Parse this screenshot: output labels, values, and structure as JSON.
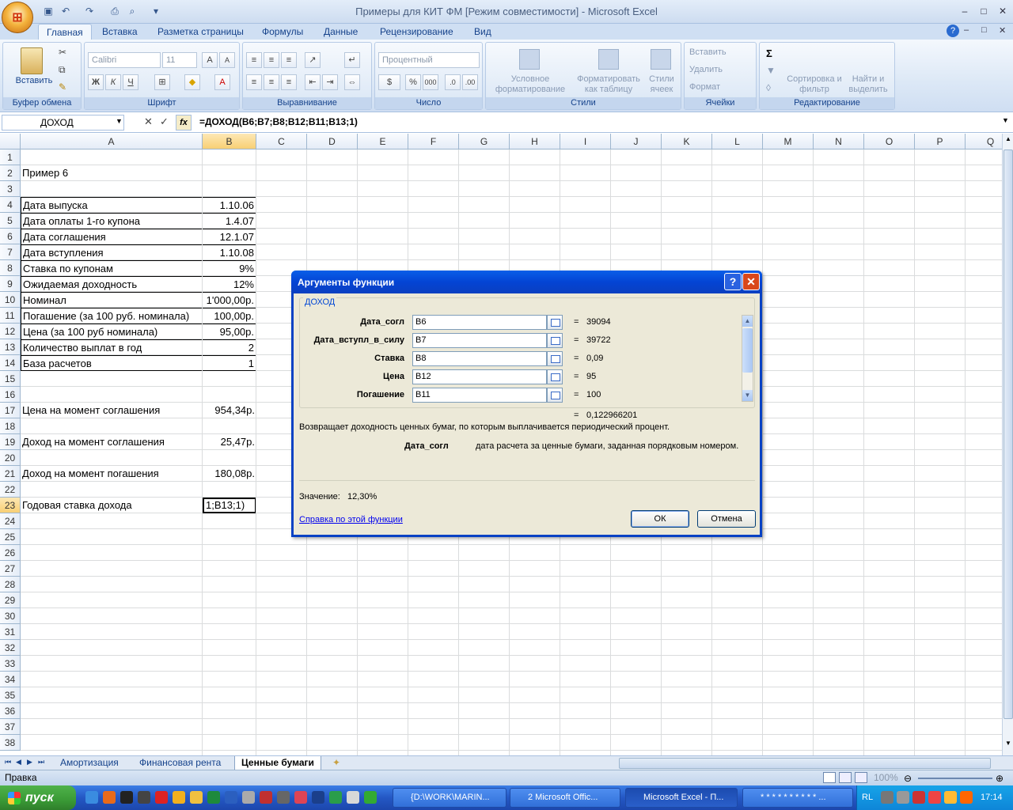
{
  "window": {
    "title": "Примеры для КИТ ФМ  [Режим совместимости] - Microsoft Excel"
  },
  "ribbon_tabs": [
    "Главная",
    "Вставка",
    "Разметка страницы",
    "Формулы",
    "Данные",
    "Рецензирование",
    "Вид"
  ],
  "ribbon": {
    "clipboard": {
      "paste": "Вставить",
      "label": "Буфер обмена"
    },
    "font": {
      "name": "Calibri",
      "size": "11",
      "label": "Шрифт"
    },
    "alignment": {
      "label": "Выравнивание"
    },
    "number": {
      "format": "Процентный",
      "label": "Число"
    },
    "styles": {
      "cond": "Условное форматирование",
      "table": "Форматировать как таблицу",
      "cell": "Стили ячеек",
      "label": "Стили"
    },
    "cells": {
      "insert": "Вставить",
      "delete": "Удалить",
      "format": "Формат",
      "label": "Ячейки"
    },
    "editing": {
      "sort": "Сортировка и фильтр",
      "find": "Найти и выделить",
      "label": "Редактирование"
    }
  },
  "formula_bar": {
    "name_box": "ДОХОД",
    "formula": "=ДОХОД(B6;B7;B8;B12;B11;B13;1)",
    "fx": "fx"
  },
  "columns": [
    "A",
    "B",
    "C",
    "D",
    "E",
    "F",
    "G",
    "H",
    "I",
    "J",
    "K",
    "L",
    "M",
    "N",
    "O",
    "P",
    "Q"
  ],
  "rows": [
    {
      "n": "1",
      "a": "",
      "b": ""
    },
    {
      "n": "2",
      "a": "Пример 6",
      "b": ""
    },
    {
      "n": "3",
      "a": "",
      "b": ""
    },
    {
      "n": "4",
      "a": "Дата выпуска",
      "b": "1.10.06"
    },
    {
      "n": "5",
      "a": "Дата оплаты 1-го купона",
      "b": "1.4.07"
    },
    {
      "n": "6",
      "a": "Дата соглашения",
      "b": "12.1.07"
    },
    {
      "n": "7",
      "a": "Дата вступления",
      "b": "1.10.08"
    },
    {
      "n": "8",
      "a": "Ставка по купонам",
      "b": "9%"
    },
    {
      "n": "9",
      "a": "Ожидаемая доходность",
      "b": "12%"
    },
    {
      "n": "10",
      "a": "Номинал",
      "b": "1'000,00р."
    },
    {
      "n": "11",
      "a": "Погашение (за 100 руб. номинала)",
      "b": "100,00р."
    },
    {
      "n": "12",
      "a": "Цена (за 100 руб номинала)",
      "b": "95,00р."
    },
    {
      "n": "13",
      "a": "Количество выплат в год",
      "b": "2"
    },
    {
      "n": "14",
      "a": "База расчетов",
      "b": "1"
    },
    {
      "n": "15",
      "a": "",
      "b": ""
    },
    {
      "n": "16",
      "a": "",
      "b": ""
    },
    {
      "n": "17",
      "a": "Цена на момент соглашения",
      "b": "954,34р."
    },
    {
      "n": "18",
      "a": "",
      "b": ""
    },
    {
      "n": "19",
      "a": "Доход на момент соглашения",
      "b": "25,47р."
    },
    {
      "n": "20",
      "a": "",
      "b": ""
    },
    {
      "n": "21",
      "a": "Доход на момент погашения",
      "b": "180,08р."
    },
    {
      "n": "22",
      "a": "",
      "b": ""
    },
    {
      "n": "23",
      "a": "Годовая ставка дохода",
      "b": "1;B13;1)"
    },
    {
      "n": "24",
      "a": "",
      "b": ""
    },
    {
      "n": "25",
      "a": "",
      "b": ""
    },
    {
      "n": "26",
      "a": "",
      "b": ""
    },
    {
      "n": "27",
      "a": "",
      "b": ""
    },
    {
      "n": "28",
      "a": "",
      "b": ""
    },
    {
      "n": "29",
      "a": "",
      "b": ""
    },
    {
      "n": "30",
      "a": "",
      "b": ""
    },
    {
      "n": "31",
      "a": "",
      "b": ""
    },
    {
      "n": "32",
      "a": "",
      "b": ""
    },
    {
      "n": "33",
      "a": "",
      "b": ""
    },
    {
      "n": "34",
      "a": "",
      "b": ""
    },
    {
      "n": "35",
      "a": "",
      "b": ""
    },
    {
      "n": "36",
      "a": "",
      "b": ""
    },
    {
      "n": "37",
      "a": "",
      "b": ""
    },
    {
      "n": "38",
      "a": "",
      "b": ""
    }
  ],
  "sheet_tabs": [
    "Амортизация",
    "Финансовая рента",
    "Ценные бумаги"
  ],
  "status": {
    "mode": "Правка",
    "zoom": "100%"
  },
  "dialog": {
    "title": "Аргументы функции",
    "function": "ДОХОД",
    "args": [
      {
        "label": "Дата_согл",
        "input": "B6",
        "value": "39094"
      },
      {
        "label": "Дата_вступл_в_силу",
        "input": "B7",
        "value": "39722"
      },
      {
        "label": "Ставка",
        "input": "B8",
        "value": "0,09"
      },
      {
        "label": "Цена",
        "input": "B12",
        "value": "95"
      },
      {
        "label": "Погашение",
        "input": "B11",
        "value": "100"
      }
    ],
    "eq": "=",
    "result": "0,122966201",
    "description": "Возвращает доходность ценных бумаг, по которым выплачивается периодический процент.",
    "arg_name": "Дата_согл",
    "arg_desc": "дата расчета за ценные бумаги, заданная порядковым номером.",
    "value_label": "Значение:",
    "value": "12,30%",
    "help": "Справка по этой функции",
    "ok": "ОК",
    "cancel": "Отмена"
  },
  "taskbar": {
    "start": "пуск",
    "buttons": [
      "{D:\\WORK\\MARIN...",
      "2 Microsoft Offic...",
      "Microsoft Excel - П...",
      "* * * * * * * * * * ..."
    ],
    "lang": "RL",
    "time": "17:14"
  }
}
